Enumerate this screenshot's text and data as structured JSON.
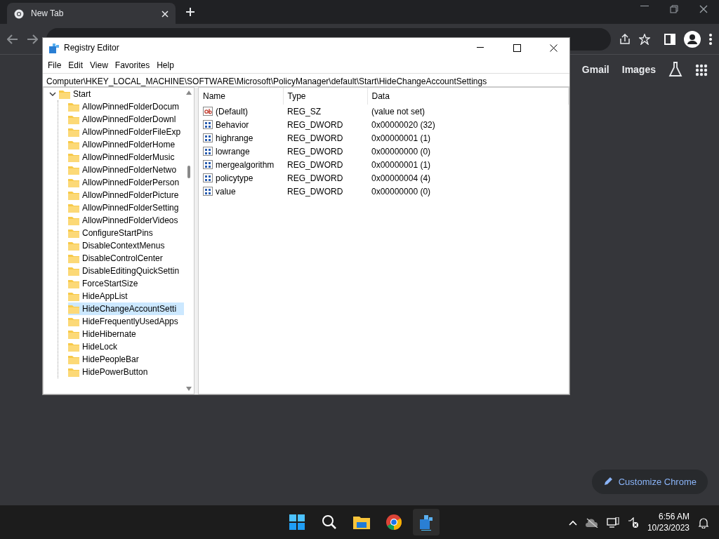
{
  "browser": {
    "tab": {
      "title": "New Tab",
      "selected": true
    },
    "top_links": [
      "Gmail",
      "Images"
    ],
    "customize_button": "Customize Chrome"
  },
  "regedit": {
    "title": "Registry Editor",
    "menu": [
      "File",
      "Edit",
      "View",
      "Favorites",
      "Help"
    ],
    "address": "Computer\\HKEY_LOCAL_MACHINE\\SOFTWARE\\Microsoft\\PolicyManager\\default\\Start\\HideChangeAccountSettings",
    "tree": [
      {
        "label": "Start",
        "expanded": true,
        "selected": false,
        "children": [
          {
            "label": "AllowPinnedFolderDocum",
            "selected": false
          },
          {
            "label": "AllowPinnedFolderDownl",
            "selected": false
          },
          {
            "label": "AllowPinnedFolderFileExp",
            "selected": false
          },
          {
            "label": "AllowPinnedFolderHome",
            "selected": false
          },
          {
            "label": "AllowPinnedFolderMusic",
            "selected": false
          },
          {
            "label": "AllowPinnedFolderNetwo",
            "selected": false
          },
          {
            "label": "AllowPinnedFolderPerson",
            "selected": false
          },
          {
            "label": "AllowPinnedFolderPicture",
            "selected": false
          },
          {
            "label": "AllowPinnedFolderSetting",
            "selected": false
          },
          {
            "label": "AllowPinnedFolderVideos",
            "selected": false
          },
          {
            "label": "ConfigureStartPins",
            "selected": false
          },
          {
            "label": "DisableContextMenus",
            "selected": false
          },
          {
            "label": "DisableControlCenter",
            "selected": false
          },
          {
            "label": "DisableEditingQuickSettin",
            "selected": false
          },
          {
            "label": "ForceStartSize",
            "selected": false
          },
          {
            "label": "HideAppList",
            "selected": false
          },
          {
            "label": "HideChangeAccountSetti",
            "selected": true
          },
          {
            "label": "HideFrequentlyUsedApps",
            "selected": false
          },
          {
            "label": "HideHibernate",
            "selected": false
          },
          {
            "label": "HideLock",
            "selected": false
          },
          {
            "label": "HidePeopleBar",
            "selected": false
          },
          {
            "label": "HidePowerButton",
            "selected": false
          }
        ]
      }
    ],
    "columns": [
      "Name",
      "Type",
      "Data"
    ],
    "values": [
      {
        "kind": "string",
        "name": "(Default)",
        "type": "REG_SZ",
        "data": "(value not set)"
      },
      {
        "kind": "binary",
        "name": "Behavior",
        "type": "REG_DWORD",
        "data": "0x00000020 (32)"
      },
      {
        "kind": "binary",
        "name": "highrange",
        "type": "REG_DWORD",
        "data": "0x00000001 (1)"
      },
      {
        "kind": "binary",
        "name": "lowrange",
        "type": "REG_DWORD",
        "data": "0x00000000 (0)"
      },
      {
        "kind": "binary",
        "name": "mergealgorithm",
        "type": "REG_DWORD",
        "data": "0x00000001 (1)"
      },
      {
        "kind": "binary",
        "name": "policytype",
        "type": "REG_DWORD",
        "data": "0x00000004 (4)"
      },
      {
        "kind": "binary",
        "name": "value",
        "type": "REG_DWORD",
        "data": "0x00000000 (0)"
      }
    ]
  },
  "taskbar": {
    "time": "6:56 AM",
    "date": "10/23/2023"
  }
}
